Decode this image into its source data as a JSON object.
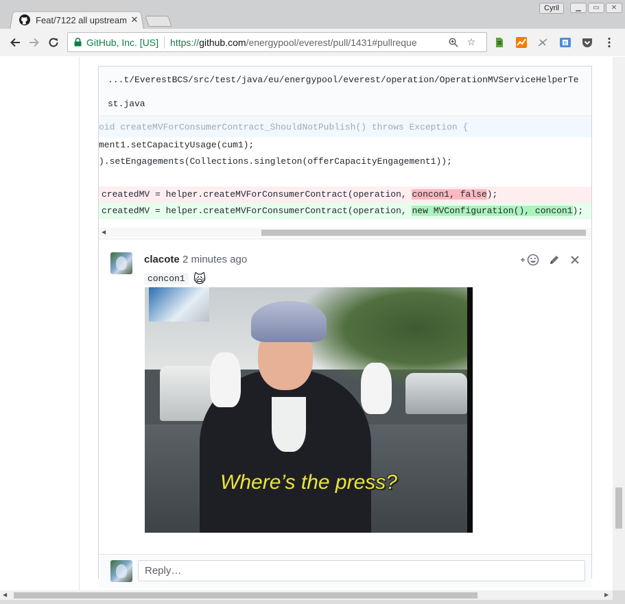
{
  "browser": {
    "tab_title": "Feat/7122 all upstream",
    "profile_name": "Cyril",
    "ev_label": "GitHub, Inc. [US]",
    "url_scheme": "https://",
    "url_host": "github.com",
    "url_path": "/energypool/everest/pull/1431#pullreque"
  },
  "file": {
    "path_line1": "...t/EverestBCS/src/test/java/eu/energypool/everest/operation/OperationMVServiceHelperTe",
    "path_line2": "st.java"
  },
  "code": {
    "hunk": "oid createMVForConsumerContract_ShouldNotPublish() throws Exception {",
    "line1": "ment1.setCapacityUsage(cum1);",
    "line2": ").setEngagements(Collections.singleton(offerCapacityEngagement1));",
    "del_prefix": "createdMV = helper.createMVForConsumerContract(operation, ",
    "del_highlight": "concon1, false",
    "del_suffix": ");",
    "add_prefix": "createdMV = helper.createMVForConsumerContract(operation, ",
    "add_highlight": "new MVConfiguration(), concon1",
    "add_suffix": ");"
  },
  "comment": {
    "author": "clacote",
    "time": "2 minutes ago",
    "mention": "concon1",
    "emoji": "🙀",
    "gif_caption": "Where’s the press?",
    "add_reaction_icon": "add-reaction-icon",
    "edit_icon": "pencil-icon",
    "delete_icon": "close-icon"
  },
  "reply": {
    "placeholder": "Reply…"
  },
  "colors": {
    "ev_green": "#0b8043",
    "diff_del_bg": "#ffeef0",
    "diff_del_hl": "#fdb8c0",
    "diff_add_bg": "#e6ffed",
    "diff_add_hl": "#acf2bd",
    "hunk_bg": "#f1f8ff"
  }
}
